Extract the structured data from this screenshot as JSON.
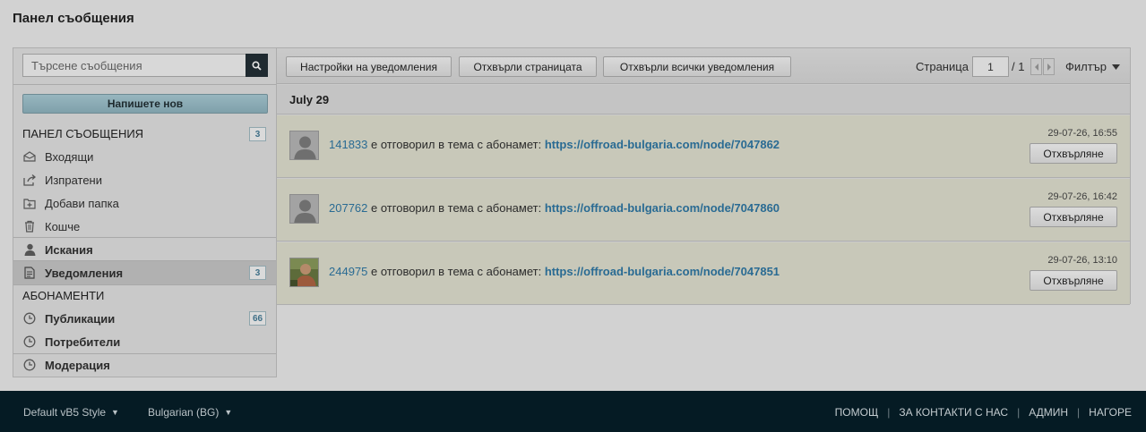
{
  "page": {
    "title": "Панел съобщения"
  },
  "search": {
    "placeholder": "Търсене съобщения"
  },
  "sidebar": {
    "compose_label": "Напишете нов",
    "messages_heading": "ПАНЕЛ СЪОБЩЕНИЯ",
    "messages_count": "3",
    "items": [
      {
        "label": "Входящи"
      },
      {
        "label": "Изпратени"
      },
      {
        "label": "Добави папка"
      },
      {
        "label": "Кошче"
      }
    ],
    "requests_label": "Искания",
    "notifications_label": "Уведомления",
    "notifications_count": "3",
    "subscriptions_heading": "АБОНАМЕНТИ",
    "publications_label": "Публикации",
    "publications_count": "66",
    "users_label": "Потребители",
    "moderation_label": "Модерация"
  },
  "toolbar": {
    "settings_label": "Настройки на уведомления",
    "reject_page_label": "Отхвърли страницата",
    "reject_all_label": "Отхвърли всички уведомления",
    "page_label": "Страница",
    "page_value": "1",
    "page_total": "/ 1",
    "filter_label": "Филтър"
  },
  "notifications": {
    "date": "July 29",
    "action_text": "е отговорил в тема с абонамет:",
    "reject_label": "Отхвърляне",
    "items": [
      {
        "user": "141833",
        "link": "https://offroad-bulgaria.com/node/7047862",
        "time": "29-07-26, 16:55"
      },
      {
        "user": "207762",
        "link": "https://offroad-bulgaria.com/node/7047860",
        "time": "29-07-26, 16:42"
      },
      {
        "user": "244975",
        "link": "https://offroad-bulgaria.com/node/7047851",
        "time": "29-07-26, 13:10"
      }
    ]
  },
  "footer": {
    "style_label": "Default vB5 Style",
    "language_label": "Bulgarian (BG)",
    "links": [
      "ПОМОЩ",
      "ЗА КОНТАКТИ С НАС",
      "АДМИН",
      "НАГОРЕ"
    ]
  },
  "colors": {
    "footer_bg": "#051b24",
    "link": "#2a6b93",
    "notification_bg": "#c8c8b9"
  }
}
